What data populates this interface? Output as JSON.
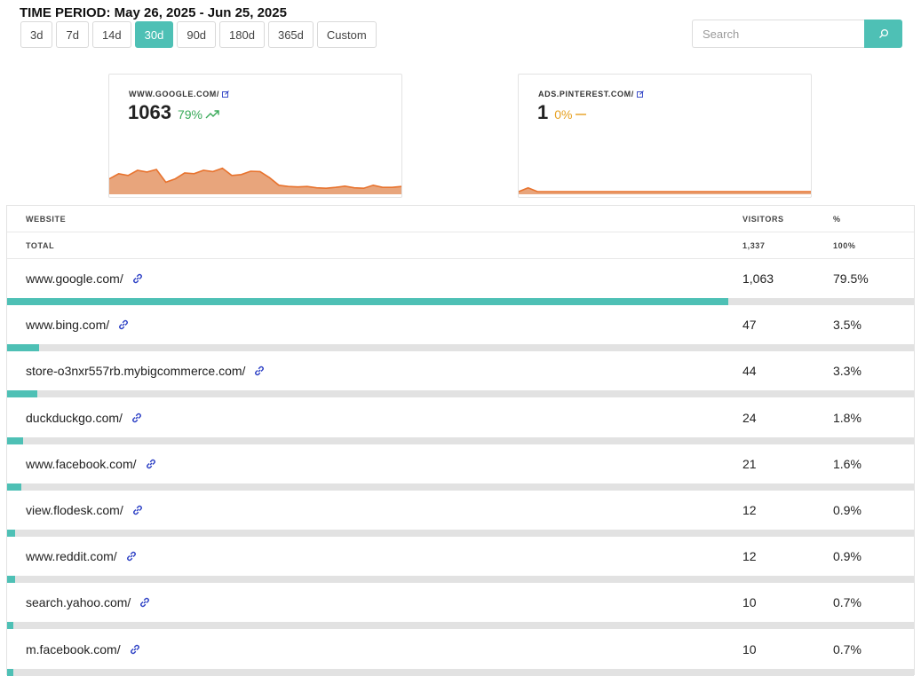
{
  "header": {
    "time_period": "TIME PERIOD: May 26, 2025 - Jun 25, 2025",
    "ranges": [
      {
        "label": "3d",
        "active": false
      },
      {
        "label": "7d",
        "active": false
      },
      {
        "label": "14d",
        "active": false
      },
      {
        "label": "30d",
        "active": true
      },
      {
        "label": "90d",
        "active": false
      },
      {
        "label": "180d",
        "active": false
      },
      {
        "label": "365d",
        "active": false
      },
      {
        "label": "Custom",
        "active": false
      }
    ]
  },
  "search": {
    "placeholder": "Search",
    "value": "",
    "icon": "search-icon"
  },
  "colors": {
    "accent": "#4ec0b5",
    "spark_stroke": "#e8732e",
    "spark_fill": "#e8a57c",
    "up": "#3aaa5a",
    "neutral": "#e6a020",
    "link": "#2a3ec4"
  },
  "cards": [
    {
      "label": "WWW.GOOGLE.COM/",
      "value": "1063",
      "change": "79%",
      "trend": "up",
      "spark": [
        0.3,
        0.42,
        0.38,
        0.5,
        0.46,
        0.52,
        0.22,
        0.3,
        0.44,
        0.42,
        0.5,
        0.47,
        0.55,
        0.38,
        0.4,
        0.48,
        0.47,
        0.33,
        0.15,
        0.12,
        0.11,
        0.12,
        0.09,
        0.08,
        0.1,
        0.13,
        0.09,
        0.08,
        0.15,
        0.1,
        0.1,
        0.12
      ]
    },
    {
      "label": "ADS.PINTEREST.COM/",
      "value": "1",
      "change": "0%",
      "trend": "flat",
      "spark": [
        0.0,
        0.09,
        0.0,
        0.0,
        0.0,
        0.0,
        0.0,
        0.0,
        0.0,
        0.0,
        0.0,
        0.0,
        0.0,
        0.0,
        0.0,
        0.0,
        0.0,
        0.0,
        0.0,
        0.0,
        0.0,
        0.0,
        0.0,
        0.0,
        0.0,
        0.0,
        0.0,
        0.0,
        0.0,
        0.0,
        0.0,
        0.0
      ]
    }
  ],
  "table": {
    "headers": {
      "website": "WEBSITE",
      "visitors": "VISITORS",
      "percent": "%"
    },
    "total": {
      "label": "TOTAL",
      "visitors": "1,337",
      "percent": "100%"
    },
    "rows": [
      {
        "site": "www.google.com/",
        "visitors": "1,063",
        "percent": "79.5%",
        "share": 0.795
      },
      {
        "site": "www.bing.com/",
        "visitors": "47",
        "percent": "3.5%",
        "share": 0.035
      },
      {
        "site": "store-o3nxr557rb.mybigcommerce.com/",
        "visitors": "44",
        "percent": "3.3%",
        "share": 0.033
      },
      {
        "site": "duckduckgo.com/",
        "visitors": "24",
        "percent": "1.8%",
        "share": 0.018
      },
      {
        "site": "www.facebook.com/",
        "visitors": "21",
        "percent": "1.6%",
        "share": 0.016
      },
      {
        "site": "view.flodesk.com/",
        "visitors": "12",
        "percent": "0.9%",
        "share": 0.009
      },
      {
        "site": "www.reddit.com/",
        "visitors": "12",
        "percent": "0.9%",
        "share": 0.009
      },
      {
        "site": "search.yahoo.com/",
        "visitors": "10",
        "percent": "0.7%",
        "share": 0.007
      },
      {
        "site": "m.facebook.com/",
        "visitors": "10",
        "percent": "0.7%",
        "share": 0.007
      }
    ]
  }
}
